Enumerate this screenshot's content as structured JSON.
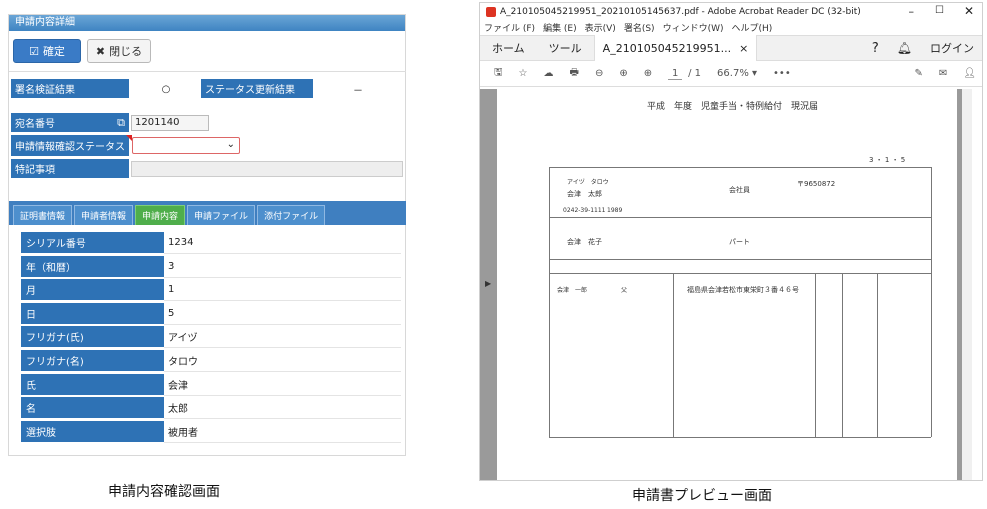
{
  "left": {
    "header": "申請内容詳細",
    "confirm_label": "確定",
    "close_label": "閉じる",
    "sig_label": "署名検証結果",
    "sig_value": "○",
    "status_update_label": "ステータス更新結果",
    "status_update_value": "－",
    "receipt_label": "宛名番号",
    "receipt_value": "1201140",
    "confirm_status_label": "申請情報確認ステータス",
    "special_label": "特記事項",
    "tabs": [
      "証明書情報",
      "申請者情報",
      "申請内容",
      "申請ファイル",
      "添付ファイル"
    ],
    "rows": [
      {
        "k": "シリアル番号",
        "v": "1234"
      },
      {
        "k": "年（和暦）",
        "v": "3"
      },
      {
        "k": "月",
        "v": "1"
      },
      {
        "k": "日",
        "v": "5"
      },
      {
        "k": "フリガナ(氏)",
        "v": "アイヅ"
      },
      {
        "k": "フリガナ(名)",
        "v": "タロウ"
      },
      {
        "k": "氏",
        "v": "会津"
      },
      {
        "k": "名",
        "v": "太郎"
      },
      {
        "k": "選択肢",
        "v": "被用者"
      }
    ],
    "caption": "申請内容確認画面"
  },
  "right": {
    "window_title": "A_210105045219951_20210105145637.pdf - Adobe Acrobat Reader DC (32-bit)",
    "menu": [
      "ファイル (F)",
      "編集 (E)",
      "表示(V)",
      "署名(S)",
      "ウィンドウ(W)",
      "ヘルプ(H)"
    ],
    "tab_home": "ホーム",
    "tab_tools": "ツール",
    "tab_doc": "A_210105045219951...",
    "login": "ログイン",
    "page_current": "1",
    "page_total": "/ 1",
    "zoom": "66.7%",
    "doc_title": "平成　年度　児童手当・特例給付　現況届",
    "postal": "〒9650872",
    "phone": "0242-39-1111",
    "furigana": "アイヅ　タロウ",
    "name": "会津　太郎",
    "spouse_name": "会津　花子",
    "company": "会社員",
    "part": "パート",
    "address": "福島県会津若松市東栄町３番４６号",
    "child_name": "会津　一郎",
    "relation": "父",
    "date": "3 ・ 1 ・ 5",
    "year1": "1989",
    "caption": "申請書プレビュー画面"
  }
}
